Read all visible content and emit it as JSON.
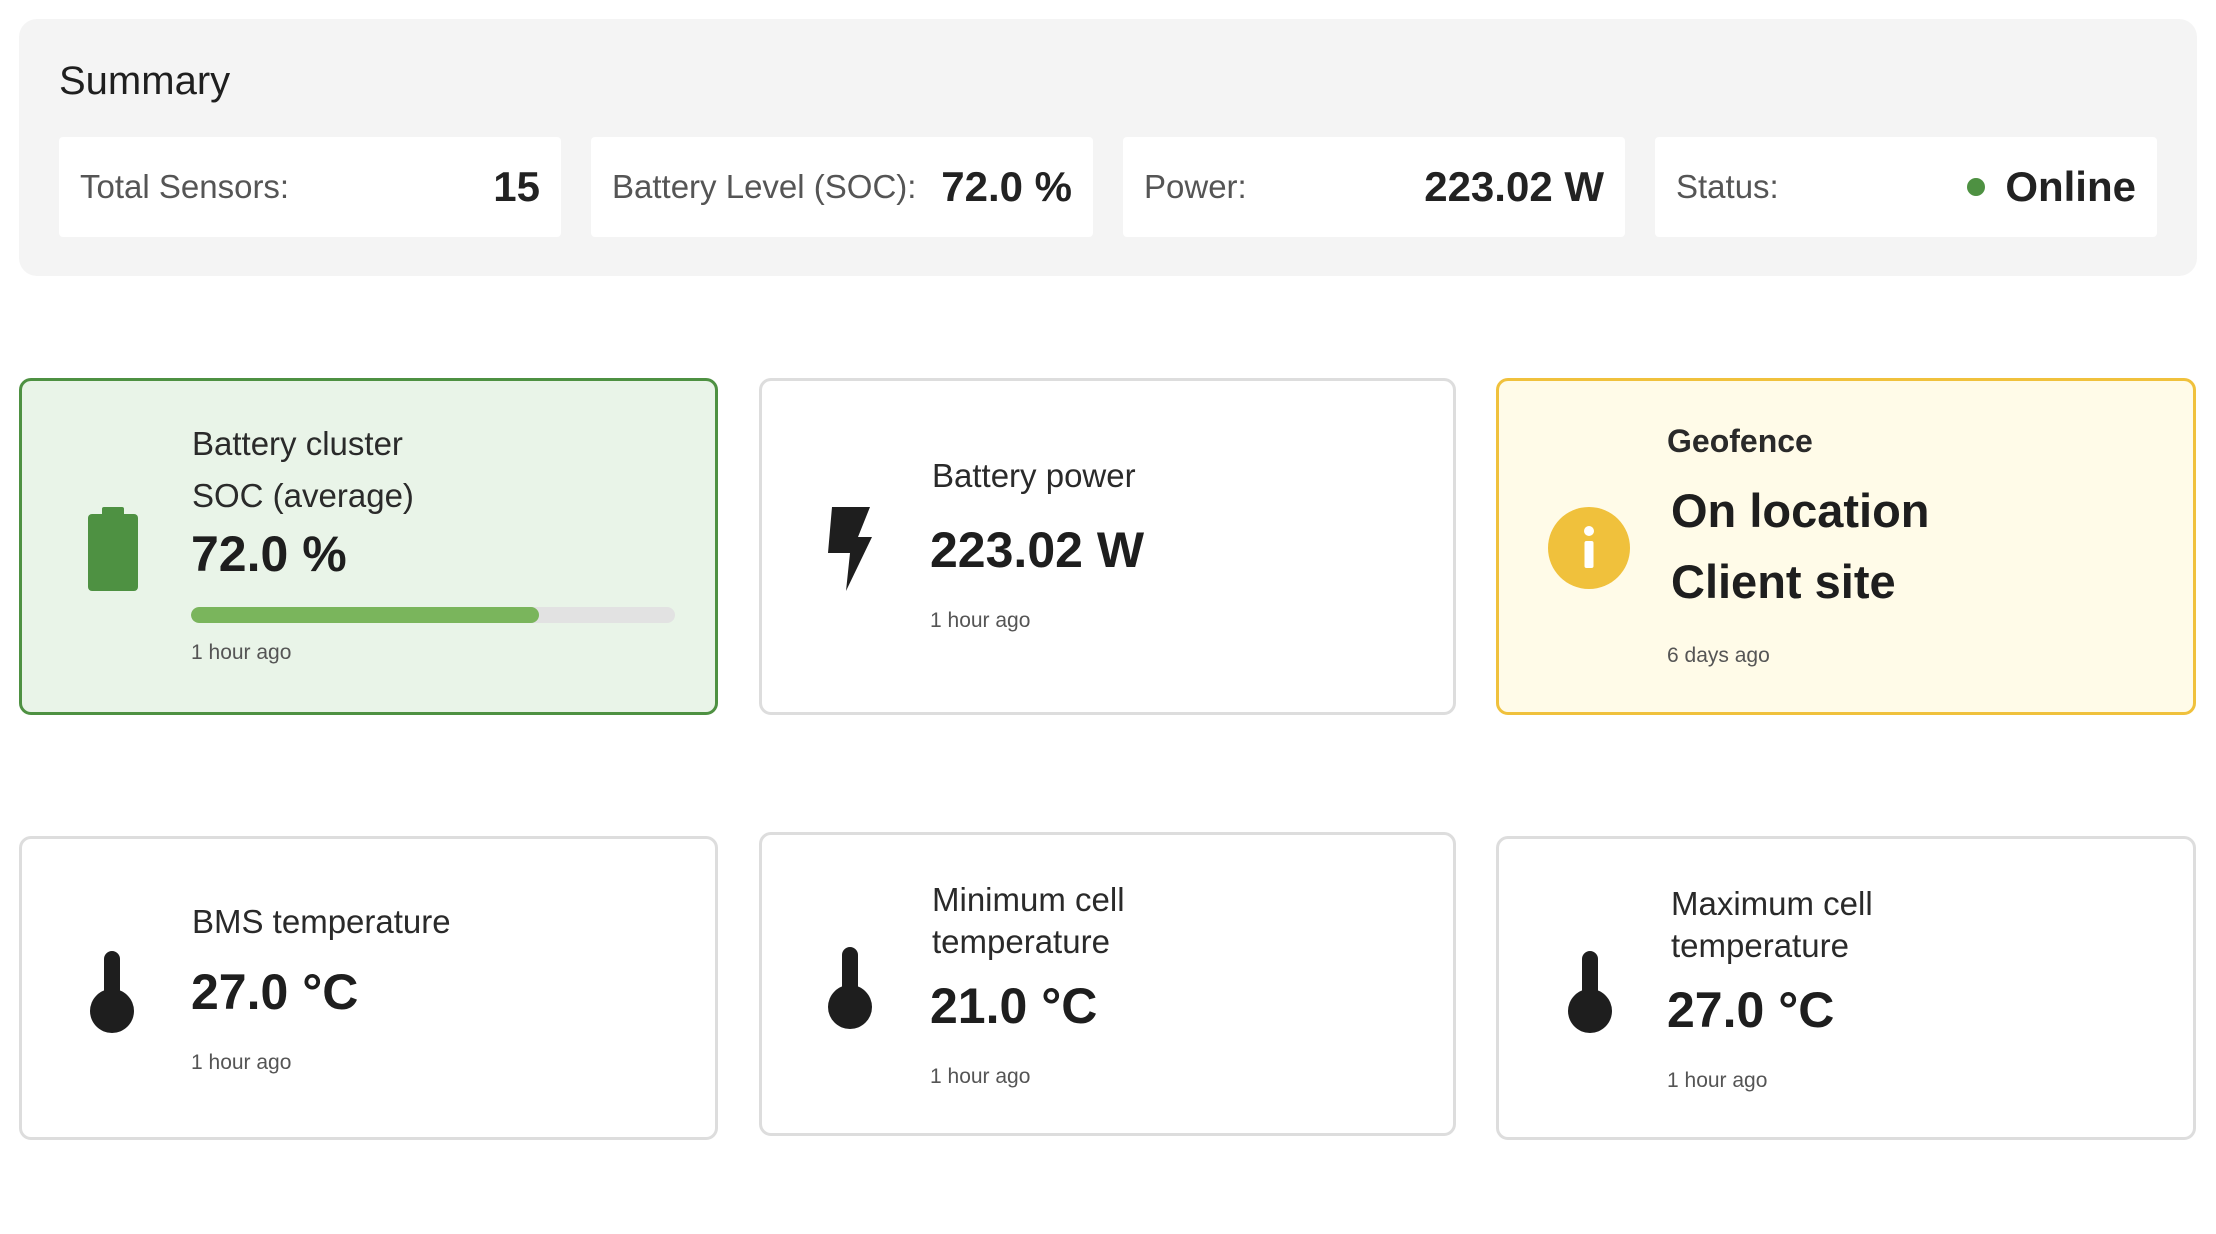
{
  "summary": {
    "title": "Summary",
    "total_sensors": {
      "label": "Total Sensors:",
      "value": "15"
    },
    "battery_level": {
      "label": "Battery Level (SOC):",
      "value": "72.0 %"
    },
    "power": {
      "label": "Power:",
      "value": "223.02 W"
    },
    "status": {
      "label": "Status:",
      "value": "Online",
      "color": "#4e9142"
    }
  },
  "cards": {
    "battery_cluster": {
      "label_line1": "Battery cluster",
      "label_line2": "SOC (average)",
      "value": "72.0 %",
      "progress_percent": 72,
      "time": "1 hour ago",
      "icon": "battery-icon",
      "color": "#4e9142"
    },
    "battery_power": {
      "label": "Battery power",
      "value": "223.02 W",
      "time": "1 hour ago",
      "icon": "lightning-icon"
    },
    "geofence": {
      "label": "Geofence",
      "value_line1": "On location",
      "value_line2": "Client site",
      "time": "6 days ago",
      "icon": "info-icon",
      "color": "#f0c13c"
    },
    "bms_temperature": {
      "label": "BMS temperature",
      "value": "27.0 °C",
      "time": "1 hour ago",
      "icon": "thermometer-icon"
    },
    "min_cell_temperature": {
      "label_line1": "Minimum cell",
      "label_line2": "temperature",
      "value": "21.0 °C",
      "time": "1 hour ago",
      "icon": "thermometer-icon"
    },
    "max_cell_temperature": {
      "label_line1": "Maximum cell",
      "label_line2": "temperature",
      "value": "27.0 °C",
      "time": "1 hour ago",
      "icon": "thermometer-icon"
    }
  }
}
